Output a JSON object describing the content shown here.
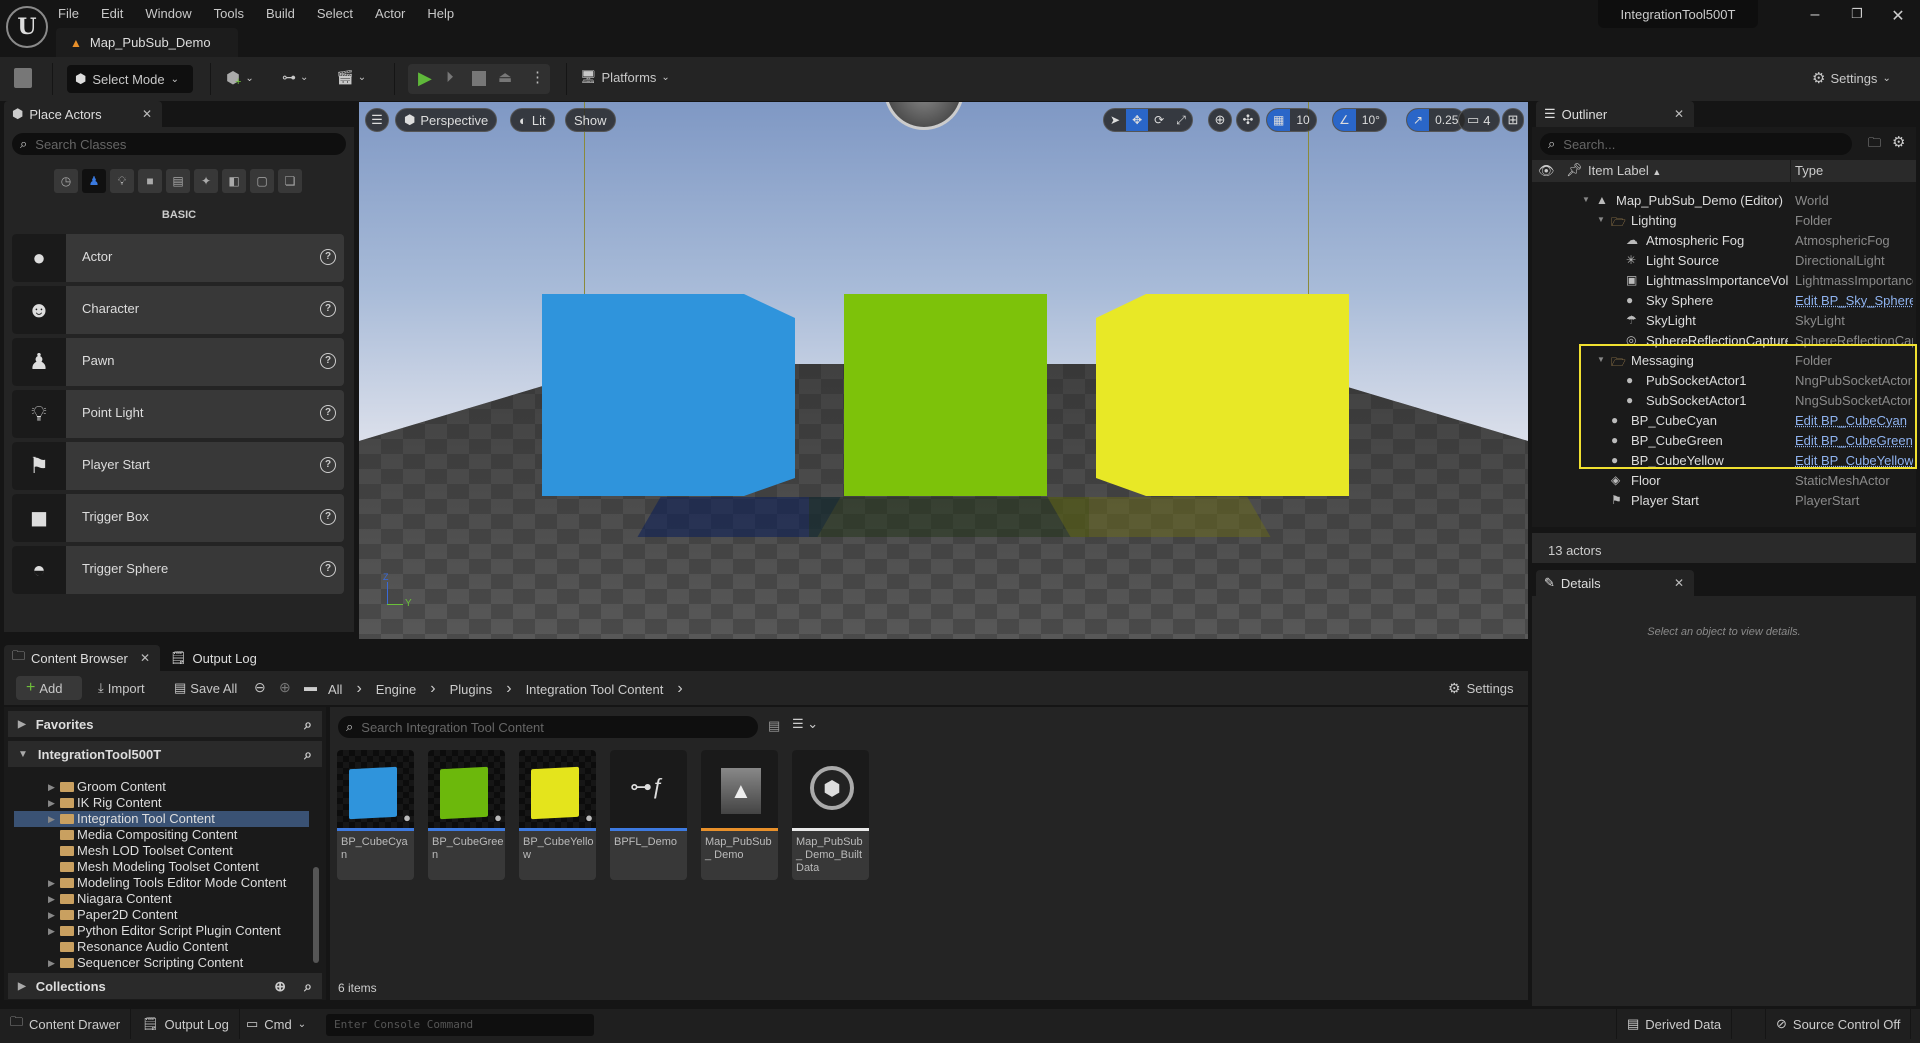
{
  "window": {
    "project_name": "IntegrationTool500T",
    "doc_tab": "Map_PubSub_Demo",
    "menu": [
      "File",
      "Edit",
      "Window",
      "Tools",
      "Build",
      "Select",
      "Actor",
      "Help"
    ],
    "controls": {
      "minimize": "–",
      "restore": "❐",
      "close": "✕"
    }
  },
  "toolbar": {
    "select_mode": "Select Mode",
    "platforms": "Platforms",
    "settings": "Settings"
  },
  "place_actors": {
    "tab": "Place Actors",
    "search_placeholder": "Search Classes",
    "category": "BASIC",
    "category_icons": [
      "recent-icon",
      "basic-icon",
      "lights-icon",
      "shapes-icon",
      "cinematic-icon",
      "visual-effects-icon",
      "geometry-icon",
      "volumes-icon",
      "all-classes-icon"
    ],
    "items": [
      {
        "label": "Actor",
        "icon": "actor-icon"
      },
      {
        "label": "Character",
        "icon": "character-icon"
      },
      {
        "label": "Pawn",
        "icon": "pawn-icon"
      },
      {
        "label": "Point Light",
        "icon": "point-light-icon"
      },
      {
        "label": "Player Start",
        "icon": "player-start-icon"
      },
      {
        "label": "Trigger Box",
        "icon": "trigger-box-icon"
      },
      {
        "label": "Trigger Sphere",
        "icon": "trigger-sphere-icon"
      }
    ]
  },
  "viewport": {
    "view_mode": "Perspective",
    "lighting": "Lit",
    "show": "Show",
    "grid_snap": "10",
    "rotation_snap": "10°",
    "scale_snap": "0.25",
    "camera_speed": "4",
    "axis_labels": {
      "z": "Z",
      "y": "Y"
    },
    "cube_colors": {
      "cyan": "#2f94dc",
      "green": "#7dc20a",
      "yellow": "#e8e826"
    }
  },
  "outliner": {
    "tab": "Outliner",
    "search_placeholder": "Search...",
    "col_label": "Item Label",
    "col_type": "Type",
    "rows": [
      {
        "name": "Map_PubSub_Demo (Editor)",
        "type": "World",
        "depth": 0,
        "kind": "world",
        "expanded": true
      },
      {
        "name": "Lighting",
        "type": "Folder",
        "depth": 1,
        "kind": "folder",
        "expanded": true
      },
      {
        "name": "Atmospheric Fog",
        "type": "AtmosphericFog",
        "depth": 2,
        "kind": "fog"
      },
      {
        "name": "Light Source",
        "type": "DirectionalLight",
        "depth": 2,
        "kind": "light"
      },
      {
        "name": "LightmassImportanceVolume",
        "type": "LightmassImportanceVolume",
        "depth": 2,
        "kind": "volume"
      },
      {
        "name": "Sky Sphere",
        "type": "Edit BP_Sky_Sphere",
        "depth": 2,
        "kind": "actor",
        "link": true
      },
      {
        "name": "SkyLight",
        "type": "SkyLight",
        "depth": 2,
        "kind": "skylight"
      },
      {
        "name": "SphereReflectionCapture",
        "type": "SphereReflectionCapture",
        "depth": 2,
        "kind": "capture"
      },
      {
        "name": "Messaging",
        "type": "Folder",
        "depth": 1,
        "kind": "folder",
        "expanded": true
      },
      {
        "name": "PubSocketActor1",
        "type": "NngPubSocketActor",
        "depth": 2,
        "kind": "actor"
      },
      {
        "name": "SubSocketActor1",
        "type": "NngSubSocketActor",
        "depth": 2,
        "kind": "actor"
      },
      {
        "name": "BP_CubeCyan",
        "type": "Edit BP_CubeCyan",
        "depth": 1,
        "kind": "actor",
        "link": true
      },
      {
        "name": "BP_CubeGreen",
        "type": "Edit BP_CubeGreen",
        "depth": 1,
        "kind": "actor",
        "link": true
      },
      {
        "name": "BP_CubeYellow",
        "type": "Edit BP_CubeYellow",
        "depth": 1,
        "kind": "actor",
        "link": true
      },
      {
        "name": "Floor",
        "type": "StaticMeshActor",
        "depth": 1,
        "kind": "mesh"
      },
      {
        "name": "Player Start",
        "type": "PlayerStart",
        "depth": 1,
        "kind": "playerstart"
      }
    ],
    "count": "13 actors",
    "highlight_color": "#f0e030"
  },
  "details": {
    "tab": "Details",
    "empty_message": "Select an object to view details."
  },
  "content_browser": {
    "tab": "Content Browser",
    "tab2": "Output Log",
    "add": "Add",
    "import": "Import",
    "save_all": "Save All",
    "breadcrumb": [
      "All",
      "Engine",
      "Plugins",
      "Integration Tool Content"
    ],
    "settings": "Settings",
    "favorites": "Favorites",
    "project": "IntegrationTool500T",
    "collections": "Collections",
    "tree": [
      {
        "label": "Groom Content",
        "arrow": true
      },
      {
        "label": "IK Rig Content",
        "arrow": true
      },
      {
        "label": "Integration Tool Content",
        "arrow": true,
        "selected": true
      },
      {
        "label": "Media Compositing Content",
        "arrow": false
      },
      {
        "label": "Mesh LOD Toolset Content",
        "arrow": false
      },
      {
        "label": "Mesh Modeling Toolset Content",
        "arrow": false
      },
      {
        "label": "Modeling Tools Editor Mode Content",
        "arrow": true
      },
      {
        "label": "Niagara Content",
        "arrow": true
      },
      {
        "label": "Paper2D Content",
        "arrow": true
      },
      {
        "label": "Python Editor Script Plugin Content",
        "arrow": true
      },
      {
        "label": "Resonance Audio Content",
        "arrow": false
      },
      {
        "label": "Sequencer Scripting Content",
        "arrow": true
      }
    ],
    "search_placeholder": "Search Integration Tool Content",
    "assets": [
      {
        "name": "BP_CubeCyan",
        "kind": "blueprint",
        "color": "#2f94dc",
        "bar": "#3d7ae0"
      },
      {
        "name": "BP_CubeGreen",
        "kind": "blueprint",
        "color": "#6cb80c",
        "bar": "#3d7ae0"
      },
      {
        "name": "BP_CubeYellow",
        "kind": "blueprint",
        "color": "#e4e41c",
        "bar": "#3d7ae0"
      },
      {
        "name": "BPFL_Demo",
        "kind": "function-library",
        "bar": "#3d7ae0"
      },
      {
        "name": "Map_PubSub_ Demo",
        "kind": "map",
        "bar": "#e8902a"
      },
      {
        "name": "Map_PubSub_ Demo_Built Data",
        "kind": "built-data",
        "bar": "#e8e8e8"
      }
    ],
    "item_count": "6 items"
  },
  "statusbar": {
    "content_drawer": "Content Drawer",
    "output_log": "Output Log",
    "cmd": "Cmd",
    "console_placeholder": "Enter Console Command",
    "derived_data": "Derived Data",
    "source_control": "Source Control Off"
  }
}
